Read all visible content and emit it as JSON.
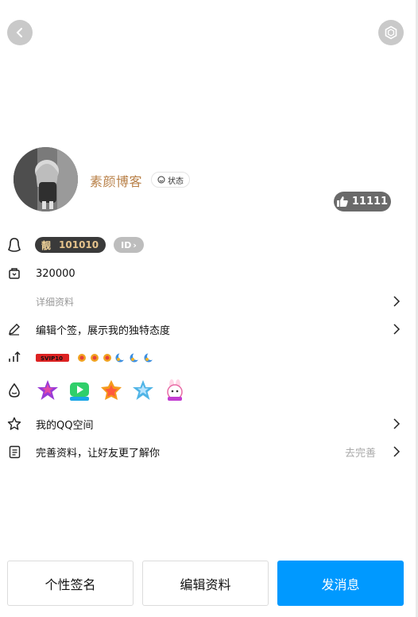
{
  "profile": {
    "nickname": "素颜博客",
    "status_label": "状态",
    "likes": "11111",
    "pretty_badge_char": "靓",
    "qq_number": "101010",
    "id_badge": "ID",
    "age_or_points": "320000"
  },
  "rows": {
    "detail": "详细资料",
    "signature": "编辑个签，展示我的独特态度",
    "qzone": "我的QQ空间",
    "complete": "完善资料，让好友更了解你",
    "complete_hint": "去完善"
  },
  "level_badges": [
    "SVIP10",
    "sun",
    "sun",
    "sun",
    "moon",
    "moon",
    "moon"
  ],
  "vip_icons": [
    "star-vip-icon",
    "video-vip-icon",
    "game-vip-icon",
    "star-vip-icon-2",
    "rabbit-vip-icon"
  ],
  "buttons": {
    "signature": "个性签名",
    "edit": "编辑资料",
    "message": "发消息"
  },
  "colors": {
    "accent": "#0099ff",
    "nickname": "#b98149",
    "badge_dark": "#3a3a3a"
  }
}
